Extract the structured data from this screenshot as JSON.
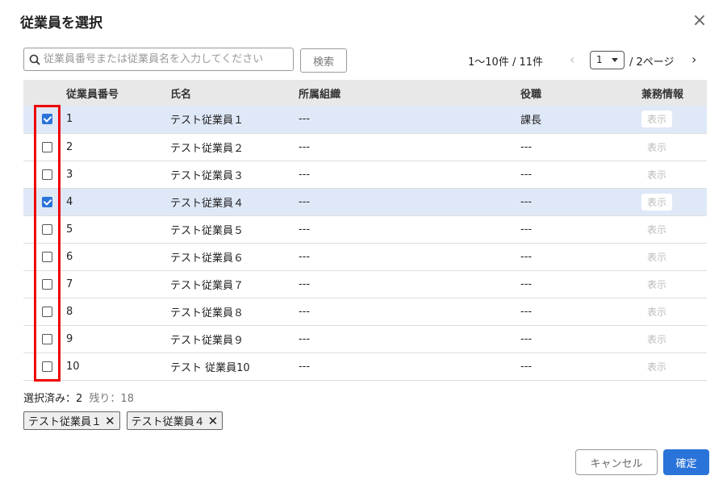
{
  "dialog": {
    "title": "従業員を選択"
  },
  "search": {
    "placeholder": "従業員番号または従業員名を入力してください",
    "button_label": "検索"
  },
  "pager": {
    "count_text": "1〜10件 / 11件",
    "page_value": "1",
    "total_text": "/ 2ページ"
  },
  "table": {
    "headers": {
      "number": "従業員番号",
      "name": "氏名",
      "org": "所属組織",
      "role": "役職",
      "concurrent": "兼務情報"
    },
    "rows": [
      {
        "checked": true,
        "number": "1",
        "name": "テスト従業員１",
        "org": "---",
        "role": "課長",
        "action": "表示"
      },
      {
        "checked": false,
        "number": "2",
        "name": "テスト従業員２",
        "org": "---",
        "role": "---",
        "action": "表示"
      },
      {
        "checked": false,
        "number": "3",
        "name": "テスト従業員３",
        "org": "---",
        "role": "---",
        "action": "表示"
      },
      {
        "checked": true,
        "number": "4",
        "name": "テスト従業員４",
        "org": "---",
        "role": "---",
        "action": "表示"
      },
      {
        "checked": false,
        "number": "5",
        "name": "テスト従業員５",
        "org": "---",
        "role": "---",
        "action": "表示"
      },
      {
        "checked": false,
        "number": "6",
        "name": "テスト従業員６",
        "org": "---",
        "role": "---",
        "action": "表示"
      },
      {
        "checked": false,
        "number": "7",
        "name": "テスト従業員７",
        "org": "---",
        "role": "---",
        "action": "表示"
      },
      {
        "checked": false,
        "number": "8",
        "name": "テスト従業員８",
        "org": "---",
        "role": "---",
        "action": "表示"
      },
      {
        "checked": false,
        "number": "9",
        "name": "テスト従業員９",
        "org": "---",
        "role": "---",
        "action": "表示"
      },
      {
        "checked": false,
        "number": "10",
        "name": "テスト 従業員10",
        "org": "---",
        "role": "---",
        "action": "表示"
      }
    ]
  },
  "selection": {
    "selected_text": "選択済み：2",
    "remaining_text": "残り：18",
    "chips": [
      "テスト従業員１",
      "テスト従業員４"
    ]
  },
  "footer": {
    "cancel_label": "キャンセル",
    "confirm_label": "確定"
  },
  "colors": {
    "accent": "#2a73d9",
    "selected_row": "#dfe8f7",
    "highlight_box": "#e00000"
  }
}
